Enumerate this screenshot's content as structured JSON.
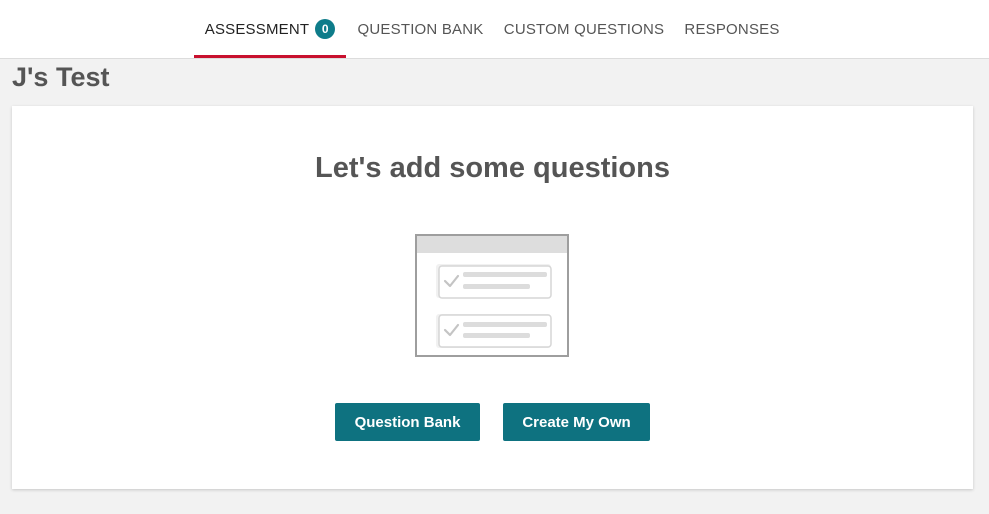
{
  "nav": {
    "tabs": [
      {
        "label": "ASSESSMENT",
        "badge": "0",
        "active": true
      },
      {
        "label": "QUESTION BANK",
        "active": false
      },
      {
        "label": "CUSTOM QUESTIONS",
        "active": false
      },
      {
        "label": "RESPONSES",
        "active": false
      }
    ]
  },
  "page": {
    "title": "J's Test"
  },
  "empty_state": {
    "heading": "Let's add some questions",
    "illustration": "questions-checklist-icon",
    "buttons": {
      "question_bank": "Question Bank",
      "create_my_own": "Create My Own"
    }
  },
  "colors": {
    "accent": "#0e7280",
    "badge": "#0e7c8a",
    "active_tab_underline": "#c8102e",
    "background": "#f2f2f2"
  }
}
